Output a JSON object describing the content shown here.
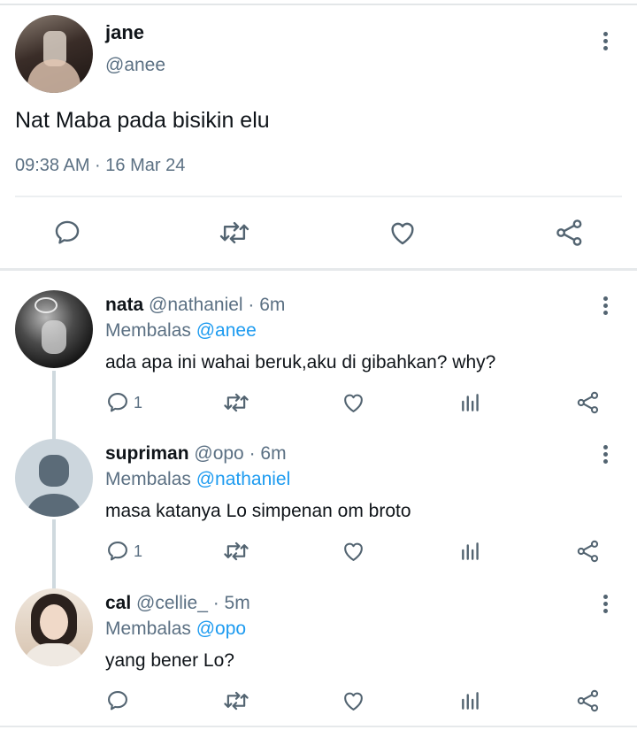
{
  "main_tweet": {
    "name": "jane",
    "handle": "@anee",
    "text": "Nat Maba pada bisikin elu",
    "timestamp": "09:38 AM · 16 Mar 24"
  },
  "replies": [
    {
      "name": "nata",
      "handle_time": "@nathaniel · 6m",
      "reply_prefix": "Membalas",
      "reply_to": "@anee",
      "text": "ada apa ini wahai beruk,aku di gibahkan? why?",
      "reply_count": "1"
    },
    {
      "name": "supriman",
      "handle_time": "@opo · 6m",
      "reply_prefix": "Membalas",
      "reply_to": "@nathaniel",
      "text": "masa katanya Lo simpenan om broto",
      "reply_count": "1"
    },
    {
      "name": "cal",
      "handle_time": "@cellie_ · 5m",
      "reply_prefix": "Membalas",
      "reply_to": "@opo",
      "text": "yang bener Lo?",
      "reply_count": ""
    }
  ],
  "colors": {
    "accent": "#1d9bf0",
    "muted": "#5b7083",
    "icon": "#536471"
  },
  "icons": [
    "more-icon",
    "comment-icon",
    "retweet-icon",
    "like-icon",
    "analytics-icon",
    "share-icon"
  ]
}
